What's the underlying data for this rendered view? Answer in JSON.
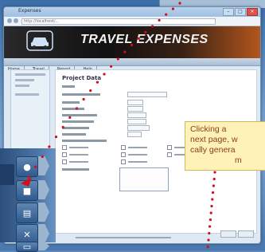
{
  "window": {
    "title": "Expenses",
    "url": "http://localhost/..."
  },
  "banner": {
    "title": "TRAVEL EXPENSES",
    "logo_icon": "car-icon"
  },
  "menu": {
    "items": [
      "Home",
      "Travel",
      "Report",
      "Help"
    ]
  },
  "form": {
    "heading": "Project Data"
  },
  "sidebar_icons": [
    {
      "name": "globe-icon",
      "glyph": "●"
    },
    {
      "name": "car-icon",
      "glyph": "■"
    },
    {
      "name": "document-icon",
      "glyph": "▤"
    },
    {
      "name": "close-icon",
      "glyph": "✕"
    },
    {
      "name": "clipboard-icon",
      "glyph": "▭"
    }
  ],
  "callout": {
    "lines": [
      "Clicking a",
      "next page, w",
      "cally genera",
      "m"
    ]
  },
  "colors": {
    "accent_dots": "#d10f1f",
    "callout_bg": "#fff2b8",
    "callout_text": "#8a3d1b"
  }
}
